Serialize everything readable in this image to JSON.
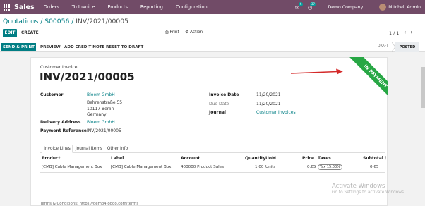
{
  "navbar": {
    "brand": "Sales",
    "menu": [
      "Orders",
      "To Invoice",
      "Products",
      "Reporting",
      "Configuration"
    ],
    "chat_badge": "6",
    "activity_badge": "37",
    "company": "Demo Company",
    "user": "Mitchell Admin",
    "apps_icon": "apps-grid-icon",
    "chat_icon": "chat-icon",
    "activity_icon": "clock-icon"
  },
  "breadcrumb": {
    "root": "Quotations",
    "order": "S00056",
    "current": "INV/2021/00005",
    "separator": " / "
  },
  "control": {
    "edit": "EDIT",
    "create": "CREATE",
    "print": "Print",
    "action": "Action",
    "pager": "1 / 1",
    "prev_icon": "‹",
    "next_icon": "›"
  },
  "statusbar": {
    "send_print": "SEND & PRINT",
    "preview": "PREVIEW",
    "add_credit_note": "ADD CREDIT NOTE",
    "reset_to_draft": "RESET TO DRAFT",
    "stage_draft": "DRAFT",
    "stage_posted": "POSTED"
  },
  "ribbon": "IN PAYMENT",
  "invoice": {
    "type_label": "Customer Invoice",
    "number": "INV/2021/00005",
    "customer_label": "Customer",
    "customer_name": "Bloem GmbH",
    "address_line1": "Behrenstraße 55",
    "address_line2": "10117 Berlin",
    "address_line3": "Germany",
    "delivery_label": "Delivery Address",
    "delivery_value": "Bloem GmbH",
    "payment_ref_label": "Payment Reference",
    "payment_ref_value": "INV/2021/00005",
    "invoice_date_label": "Invoice Date",
    "invoice_date_value": "11/20/2021",
    "due_date_label": "Due Date",
    "due_date_value": "11/20/2021",
    "journal_label": "Journal",
    "journal_value": "Customer Invoices"
  },
  "tabs": [
    "Invoice Lines",
    "Journal Items",
    "Other Info"
  ],
  "table": {
    "headers": {
      "product": "Product",
      "label": "Label",
      "account": "Account",
      "quantity": "Quantity",
      "uom": "UoM",
      "price": "Price",
      "taxes": "Taxes",
      "subtotal": "Subtotal"
    },
    "rows": [
      {
        "product": "[CMB] Cable Management Box",
        "label": "[CMB] Cable Management Box",
        "account": "400000 Product Sales",
        "quantity": "1.00",
        "uom": "Units",
        "price": "0.65",
        "taxes": "Tax 15.00%",
        "subtotal": "0.65"
      }
    ]
  },
  "terms": "Terms & Conditions: https://demo4.odoo.com/terms",
  "watermark": {
    "line1": "Activate Windows",
    "line2": "Go to Settings to activate Windows."
  },
  "colors": {
    "navbar": "#714b67",
    "primary": "#017e84",
    "ribbon": "#28a745",
    "arrow": "#d42a2a"
  }
}
